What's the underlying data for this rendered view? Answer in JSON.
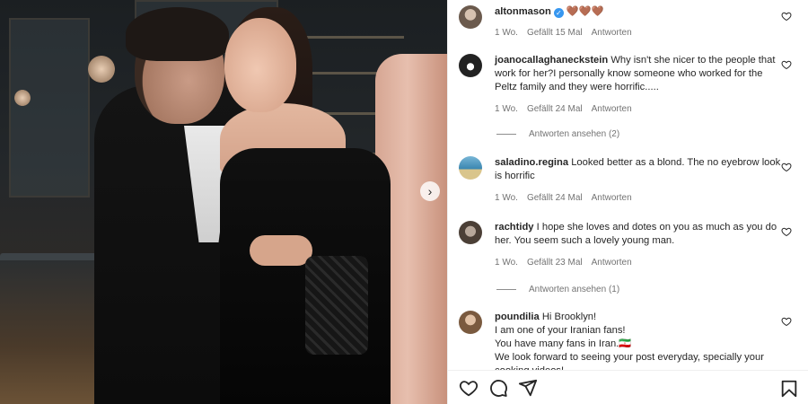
{
  "post": {
    "author": "altonmason",
    "caption_emoji": "🤎🤎🤎",
    "time": "1 Wo.",
    "likes": "Gefällt 15 Mal",
    "reply": "Antworten"
  },
  "comments": [
    {
      "user": "joanocallaghaneckstein",
      "text": "Why isn't she nicer to the people that work for her?I personally know someone who worked for the Peltz family and they were horrific.....",
      "time": "1 Wo.",
      "likes": "Gefällt 24 Mal",
      "reply": "Antworten",
      "view_replies": "Antworten ansehen (2)"
    },
    {
      "user": "saladino.regina",
      "text": "Looked better as a blond. The no eyebrow look is horrific",
      "time": "1 Wo.",
      "likes": "Gefällt 24 Mal",
      "reply": "Antworten"
    },
    {
      "user": "rachtidy",
      "text": "I hope she loves and dotes on you as much as you do her. You seem such a lovely young man.",
      "time": "1 Wo.",
      "likes": "Gefällt 23 Mal",
      "reply": "Antworten",
      "view_replies": "Antworten ansehen (1)"
    },
    {
      "user": "poundilia",
      "line1": "Hi Brooklyn!",
      "line2": "I am one of your Iranian fans!",
      "line3": "You have many fans in Iran.🇮🇷",
      "line4": "We look forward to seeing your post everyday, specially your cooking videos!"
    }
  ],
  "icons": {
    "like": "heart-icon",
    "comment": "comment-icon",
    "share": "share-icon",
    "save": "bookmark-icon",
    "next": "chevron-right-icon"
  }
}
